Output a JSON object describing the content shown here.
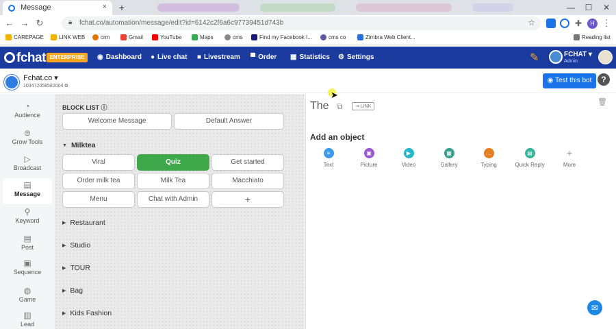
{
  "browser": {
    "tab_title": "Message",
    "tab_close": "×",
    "new_tab": "+",
    "url": "fchat.co/automation/message/edit?id=6142c2f6a6c97739451d743b",
    "window_controls": [
      "—",
      "☐",
      "✕"
    ],
    "profile_initial": "H",
    "reading_list": "Reading list",
    "bookmarks": [
      {
        "label": "CAREPAGE",
        "color": "#f2b300"
      },
      {
        "label": "LINK WEB",
        "color": "#f2b300"
      },
      {
        "label": "crm",
        "color": "#e37400"
      },
      {
        "label": "Gmail",
        "color": "#ea4335"
      },
      {
        "label": "YouTube",
        "color": "#ff0000"
      },
      {
        "label": "Maps",
        "color": "#34a853"
      },
      {
        "label": "cms",
        "color": "#888888"
      },
      {
        "label": "Find my Facebook I...",
        "color": "#1a1a7a"
      },
      {
        "label": "cms co",
        "color": "#5b5b9f"
      },
      {
        "label": "Zimbra Web Client...",
        "color": "#2a6fdb"
      }
    ]
  },
  "app": {
    "logo": "fchat",
    "badge": "ENTERPRISE",
    "nav": [
      {
        "label": "Dashboard",
        "icon": "◉"
      },
      {
        "label": "Live chat",
        "icon": "●"
      },
      {
        "label": "Livestream",
        "icon": "■"
      },
      {
        "label": "Order",
        "icon": "▀"
      },
      {
        "label": "Statistics",
        "icon": "▦"
      },
      {
        "label": "Settings",
        "icon": "⚙"
      }
    ],
    "account_name": "FCHAT",
    "account_role": "Admin",
    "brand_color": "#1a3a9e"
  },
  "page": {
    "name": "Fchat.co",
    "page_id": "103472058582004",
    "test_button": "Test this bot",
    "help": "?"
  },
  "sidebar": [
    {
      "label": "Audience",
      "icon": "◔"
    },
    {
      "label": "Grow Tools",
      "icon": "⊜"
    },
    {
      "label": "Broadcast",
      "icon": "▷"
    },
    {
      "label": "Message",
      "icon": "▤",
      "active": true
    },
    {
      "label": "Keyword",
      "icon": "⚲"
    },
    {
      "label": "Post",
      "icon": "▤"
    },
    {
      "label": "Sequence",
      "icon": "▣"
    },
    {
      "label": "Game",
      "icon": "◍"
    },
    {
      "label": "Lead",
      "icon": "▥"
    }
  ],
  "blocks": {
    "title": "BLOCK LIST",
    "default_blocks": [
      "Welcome Message",
      "Default Answer"
    ],
    "open_group": "Milktea",
    "items": [
      "Viral",
      "Quiz",
      "Get started",
      "Order milk tea",
      "Milk Tea",
      "Macchiato",
      "Menu",
      "Chat with Admin",
      "+"
    ],
    "selected": "Quiz",
    "groups": [
      "Restaurant",
      "Studio",
      "TOUR",
      "Bag",
      "Kids Fashion"
    ]
  },
  "editor": {
    "block_name": "The",
    "link_label": "LINK",
    "add_object": "Add an object",
    "objects": [
      {
        "label": "Text",
        "color": "#3d9be9"
      },
      {
        "label": "Picture",
        "color": "#9b59d0"
      },
      {
        "label": "Video",
        "color": "#26b7c9"
      },
      {
        "label": "Gallery",
        "color": "#3a9e8e"
      },
      {
        "label": "Typing",
        "color": "#e67e22"
      },
      {
        "label": "Quick Reply",
        "color": "#36b39a"
      },
      {
        "label": "More",
        "color": "#bbbbbb"
      }
    ]
  }
}
